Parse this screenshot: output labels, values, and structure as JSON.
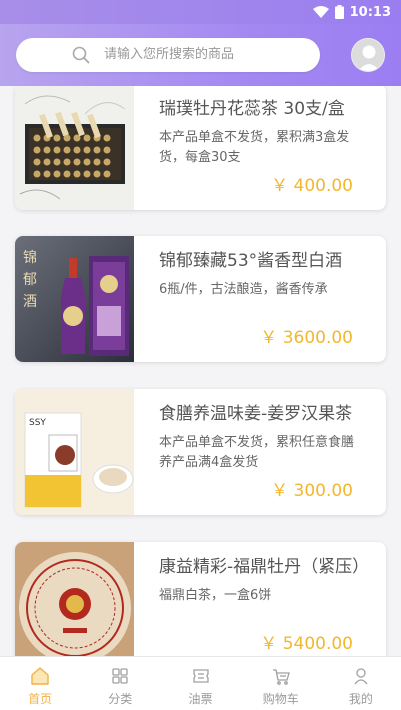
{
  "status_bar": {
    "time": "10:13"
  },
  "search": {
    "placeholder": "请输入您所搜索的商品"
  },
  "products": [
    {
      "title": "瑞璞牡丹花蕊茶 30支/盒",
      "desc": "本产品单盒不发货，累积满3盒发货，每盒30支",
      "price": "￥ 400.00"
    },
    {
      "title": "锦郁臻藏53°酱香型白酒",
      "desc": "6瓶/件，古法酿造，酱香传承",
      "price": "￥ 3600.00"
    },
    {
      "title": "食膳养温味姜-姜罗汉果茶",
      "desc": "本产品单盒不发货，累积任意食膳养产品满4盒发货",
      "price": "￥ 300.00"
    },
    {
      "title": "康益精彩-福鼎牡丹（紧压）",
      "desc": "福鼎白茶，一盒6饼",
      "price": "￥ 5400.00"
    }
  ],
  "tabs": [
    {
      "label": "首页",
      "icon": "home-icon",
      "active": true
    },
    {
      "label": "分类",
      "icon": "grid-icon",
      "active": false
    },
    {
      "label": "油票",
      "icon": "ticket-icon",
      "active": false
    },
    {
      "label": "购物车",
      "icon": "cart-icon",
      "active": false
    },
    {
      "label": "我的",
      "icon": "user-icon",
      "active": false
    }
  ],
  "colors": {
    "accent": "#9b7ef2",
    "price": "#f2b72d",
    "tab_active": "#f0b24a"
  }
}
